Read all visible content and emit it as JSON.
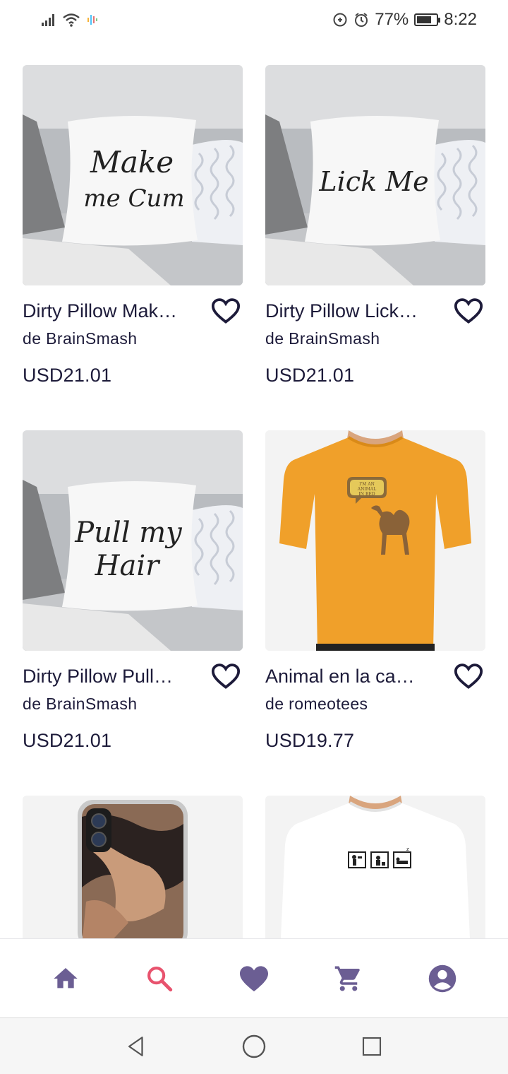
{
  "status_bar": {
    "battery_text": "77%",
    "battery_level": 0.77,
    "time": "8:22",
    "icons": [
      "signal-icon",
      "wifi-icon",
      "activity-icon",
      "data-saver-icon",
      "alarm-icon",
      "battery-icon"
    ]
  },
  "products": [
    {
      "title": "Dirty Pillow Mak…",
      "artist": "de BrainSmash",
      "price": "USD21.01",
      "image_text_1": "Make",
      "image_text_2": "me Cum",
      "image_kind": "pillow"
    },
    {
      "title": "Dirty Pillow Lick…",
      "artist": "de BrainSmash",
      "price": "USD21.01",
      "image_text_1": "Lick Me",
      "image_text_2": "",
      "image_kind": "pillow"
    },
    {
      "title": "Dirty Pillow Pull…",
      "artist": "de BrainSmash",
      "price": "USD21.01",
      "image_text_1": "Pull my",
      "image_text_2": "Hair",
      "image_kind": "pillow"
    },
    {
      "title": "Animal en la ca…",
      "artist": "de romeotees",
      "price": "USD19.77",
      "image_text_1": "I'M AN",
      "image_text_2": "ANIMAL",
      "image_text_3": "IN BED",
      "image_kind": "orange-tshirt"
    },
    {
      "title": "",
      "artist": "",
      "price": "",
      "image_kind": "phone-case"
    },
    {
      "title": "",
      "artist": "",
      "price": "",
      "image_kind": "white-tshirt"
    }
  ],
  "bottom_nav": {
    "items": [
      {
        "name": "home",
        "icon": "home-icon"
      },
      {
        "name": "search",
        "icon": "search-icon",
        "active": true
      },
      {
        "name": "favorites",
        "icon": "heart-icon"
      },
      {
        "name": "cart",
        "icon": "cart-icon"
      },
      {
        "name": "account",
        "icon": "account-icon"
      }
    ]
  },
  "colors": {
    "text": "#1d1b3a",
    "nav_icon": "#6b5e93",
    "active_nav_icon": "#e8536e",
    "orange_shirt": "#f0a02a"
  }
}
